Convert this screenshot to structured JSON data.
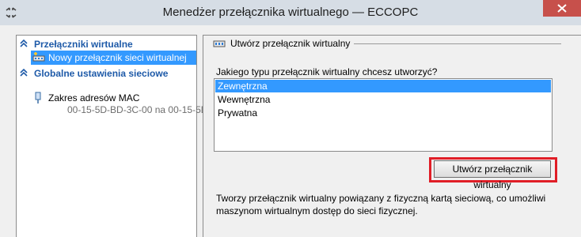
{
  "window": {
    "title": "Menedżer przełącznika wirtualnego — ECCOPC",
    "icons": {
      "app": "network-switch-icon",
      "close": "close-icon"
    }
  },
  "sidebar": {
    "section_virtual_switches": {
      "label": "Przełączniki wirtualne",
      "icon": "chevron-up-double-icon",
      "items": [
        {
          "label": "Nowy przełącznik sieci wirtualnej",
          "icon": "new-virtual-switch-icon",
          "selected": true
        }
      ]
    },
    "section_global": {
      "label": "Globalne ustawienia sieciowe",
      "icon": "chevron-up-double-icon",
      "items": [
        {
          "label": "Zakres adresów MAC",
          "sub": "00-15-5D-BD-3C-00 na 00-15-5D-...",
          "icon": "network-adapter-icon"
        }
      ]
    }
  },
  "main": {
    "group_title": "Utwórz przełącznik wirtualny",
    "group_icon": "virtual-switch-icon",
    "question": "Jakiego typu przełącznik wirtualny chcesz utworzyć?",
    "switch_types": [
      {
        "label": "Zewnętrzna",
        "selected": true
      },
      {
        "label": "Wewnętrzna",
        "selected": false
      },
      {
        "label": "Prywatna",
        "selected": false
      }
    ],
    "create_button": "Utwórz przełącznik wirtualny",
    "description_line1": "Tworzy przełącznik wirtualny powiązany z fizyczną kartą sieciową, co umożliwi",
    "description_line2": "maszynom wirtualnym dostęp do sieci fizycznej."
  },
  "colors": {
    "selection": "#3399ff",
    "section_header": "#1e5aa8",
    "highlight_border": "#e01e27",
    "close_button": "#c7504b"
  }
}
